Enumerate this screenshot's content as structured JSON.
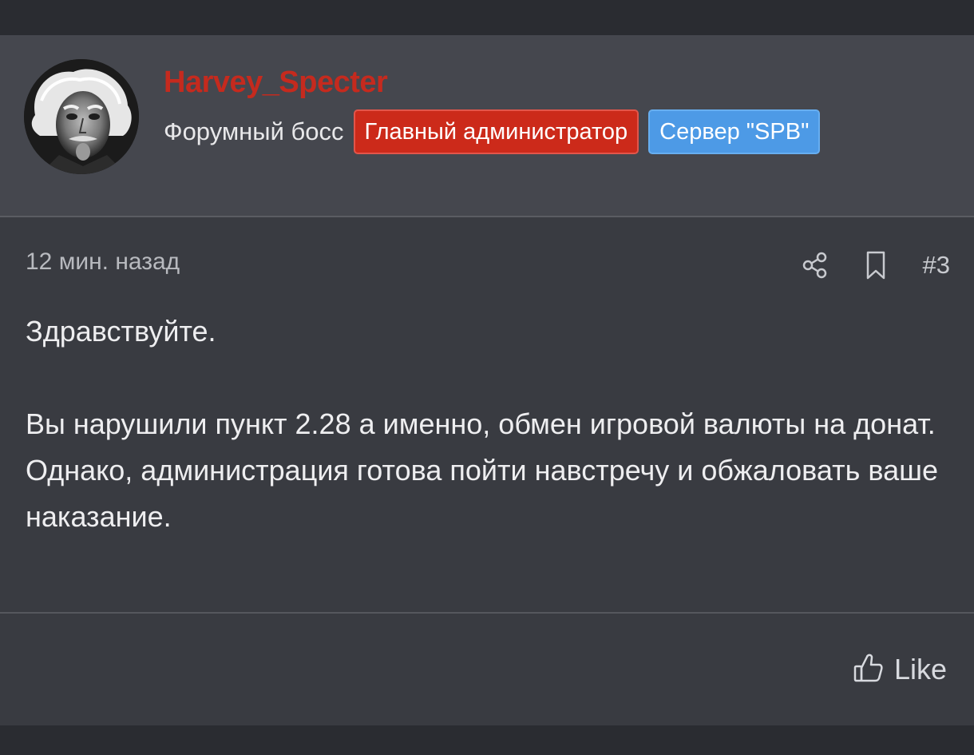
{
  "post": {
    "author": {
      "username": "Harvey_Specter",
      "title": "Форумный босс",
      "badges": [
        {
          "label": "Главный администратор",
          "color": "#cc2a1a"
        },
        {
          "label": "Сервер \"SPB\"",
          "color": "#4d9ae6"
        }
      ],
      "avatar_icon": "einstein-portrait"
    },
    "timestamp": "12 мин. назад",
    "number": "#3",
    "icons": {
      "share": "share-icon",
      "bookmark": "bookmark-icon",
      "like": "thumbs-up-icon"
    },
    "message": {
      "greeting": "Здравствуйте.",
      "line1": "Вы нарушили пункт 2.28 а именно, обмен игровой валюты на донат.",
      "line2": "Однако, администрация готова пойти навстречу и обжаловать ваше наказание."
    },
    "like_label": "Like"
  },
  "colors": {
    "username": "#c52a1e",
    "header_bg": "#45474e",
    "body_bg": "#393b41"
  }
}
